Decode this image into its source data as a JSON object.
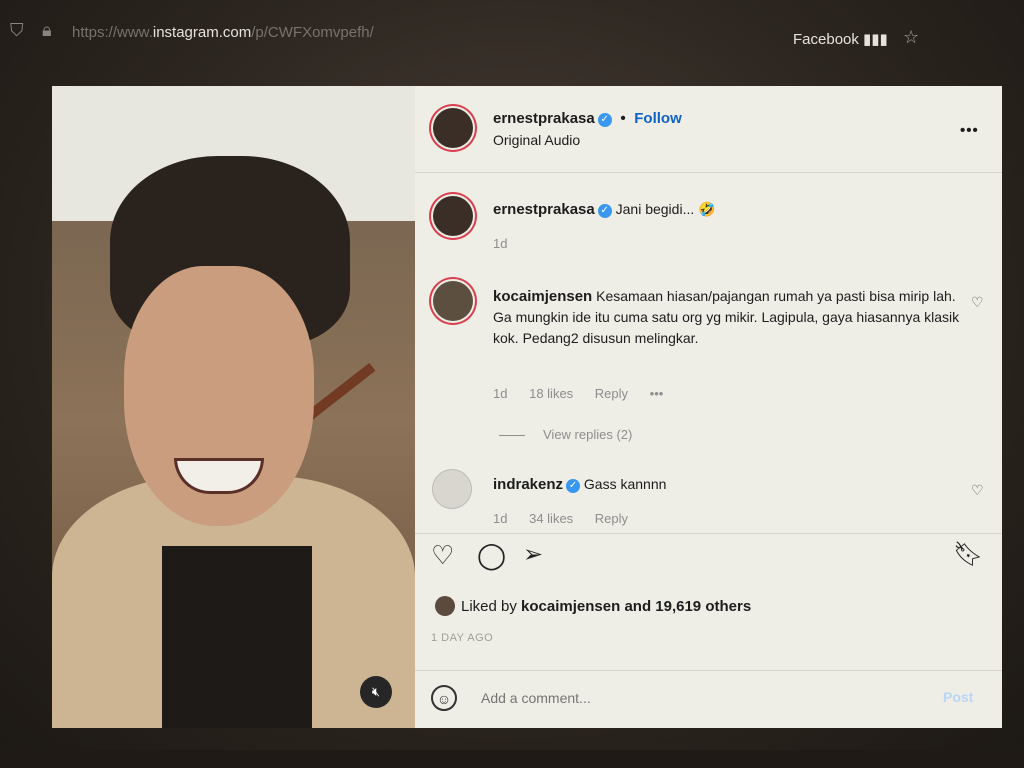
{
  "browser": {
    "url_host": "instagram.com",
    "url_prefix": "https://www.",
    "url_path": "/p/CWFXomvpefh/",
    "bookmark": "Facebook",
    "icons": [
      "shield-icon",
      "lock-icon",
      "star-icon"
    ]
  },
  "post": {
    "author": "ernestprakasa",
    "audio": "Original Audio",
    "follow_label": "Follow",
    "more_label": "•••",
    "caption": {
      "user": "ernestprakasa",
      "text": "Jani begidi... 🤣",
      "time": "1d"
    },
    "comments": [
      {
        "user": "kocaimjensen",
        "text": "Kesamaan hiasan/pajangan rumah ya pasti bisa mirip lah. Ga mungkin ide itu cuma satu org yg mikir. Lagipula, gaya hiasannya klasik kok. Pedang2 disusun melingkar.",
        "time": "1d",
        "likes": "18 likes",
        "reply": "Reply",
        "more": "•••",
        "view_replies": "View replies (2)"
      },
      {
        "user": "indrakenz",
        "text": "Gass kannnn",
        "time": "1d",
        "likes": "34 likes",
        "reply": "Reply"
      }
    ],
    "liked_by_prefix": "Liked by",
    "liked_by_user": "kocaimjensen",
    "liked_by_suffix": "and 19,619 others",
    "timestamp": "1 DAY AGO",
    "comment_placeholder": "Add a comment...",
    "post_label": "Post"
  },
  "colors": {
    "accent_blue": "#0f63c4",
    "verified": "#3897f0",
    "story_ring": "#d8404f"
  }
}
